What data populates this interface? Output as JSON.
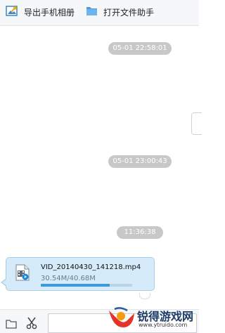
{
  "toolbar": {
    "export_album_label": "导出手机相册",
    "open_folder_label": "打开文件助手"
  },
  "messages": {
    "timestamps": [
      "05-01 22:58:01",
      "05-01 23:00:43",
      "11:36:38"
    ],
    "file": {
      "name": "VID_20140430_141218.mp4",
      "size_progress": "30.54M/40.68M",
      "progress_fraction": 0.75
    }
  },
  "watermark": {
    "title": "锐得游戏网",
    "url": "www.ytruido.com"
  },
  "colors": {
    "accent": "#3a9ad9",
    "bubble_bg": "#d6ebfa",
    "timestamp_bg": "#c8c8c8",
    "watermark_text": "#1f3c66"
  },
  "icons": {
    "export_album": "image-export-icon",
    "open_folder": "folder-icon",
    "file": "video-file-icon",
    "bottom_left": "folder-outline-icon",
    "scissors": "scissors-icon"
  }
}
